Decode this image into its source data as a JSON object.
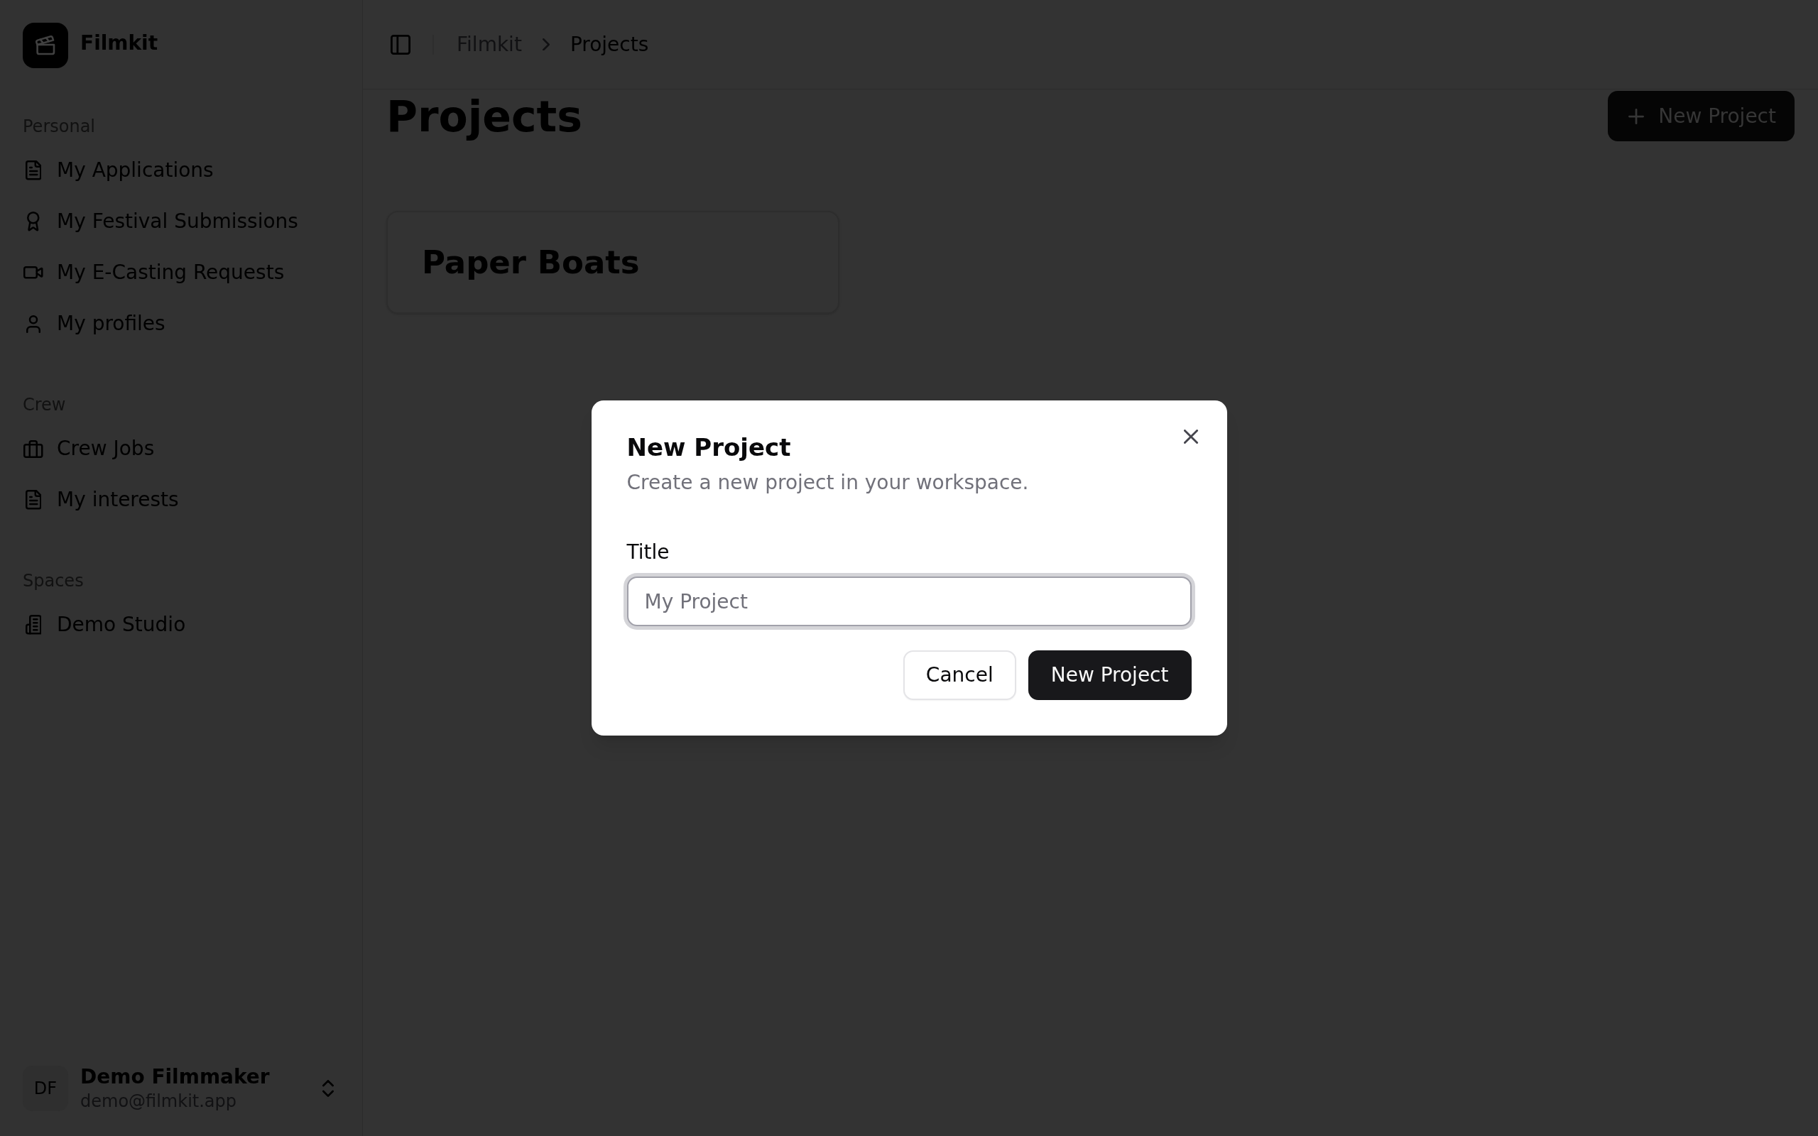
{
  "sidebar": {
    "app_name": "Filmkit",
    "groups": [
      {
        "label": "Personal",
        "items": [
          {
            "label": "My Applications",
            "selected": false
          },
          {
            "label": "My Festival Submissions",
            "selected": false
          },
          {
            "label": "My E-Casting Requests",
            "selected": false
          },
          {
            "label": "My profiles",
            "selected": false
          }
        ]
      },
      {
        "label": "Crew",
        "items": [
          {
            "label": "Crew Jobs",
            "selected": false
          },
          {
            "label": "My interests",
            "selected": false
          }
        ]
      },
      {
        "label": "Spaces",
        "items": [
          {
            "label": "Demo Studio",
            "selected": false
          }
        ]
      }
    ],
    "user": {
      "initials": "DF",
      "name": "Demo Filmmaker",
      "email": "demo@filmkit.app"
    }
  },
  "header": {
    "breadcrumb": [
      {
        "label": "Filmkit",
        "current": false
      },
      {
        "label": "Projects",
        "current": true
      }
    ]
  },
  "page": {
    "title": "Projects",
    "action_button": "New Project",
    "projects": [
      {
        "title": "Paper Boats"
      }
    ]
  },
  "dialog": {
    "title": "New Project",
    "description": "Create a new project in your workspace.",
    "fields": [
      {
        "label": "Title",
        "placeholder": "My Project",
        "focused": true
      }
    ],
    "buttons": [
      {
        "label": "Cancel",
        "kind": "secondary"
      },
      {
        "label": "New Project",
        "kind": "primary"
      }
    ]
  }
}
